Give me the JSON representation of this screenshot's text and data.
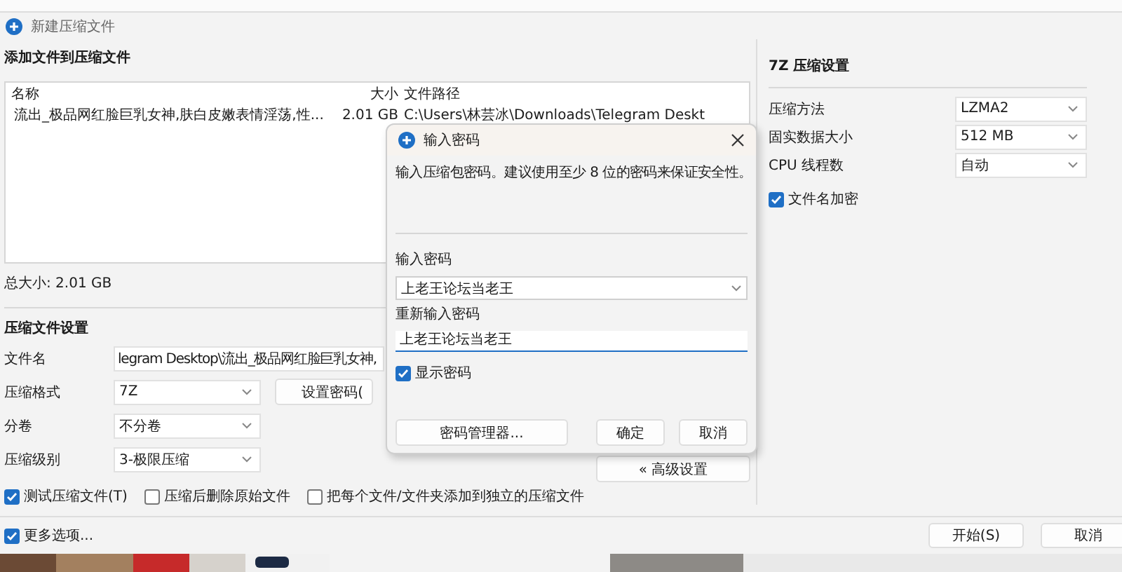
{
  "window": {
    "title": "新建压缩文件"
  },
  "add_section": {
    "heading": "添加文件到压缩文件",
    "columns": [
      "名称",
      "大小",
      "文件路径"
    ],
    "files": [
      {
        "name": "流出_极品网红脸巨乳女神,肤白皮嫩表情淫荡,性...",
        "size": "2.01 GB",
        "path": "C:\\Users\\林芸冰\\Downloads\\Telegram Deskt"
      }
    ],
    "total": "总大小: 2.01 GB"
  },
  "settings": {
    "heading": "压缩文件设置",
    "fields": [
      {
        "label": "文件名",
        "kind": "input",
        "value": "legram Desktop\\流出_极品网红脸巨乳女神,"
      },
      {
        "label": "压缩格式",
        "kind": "select",
        "value": "7Z",
        "button": {
          "label": "设置密码(",
          "kind": "inline"
        }
      },
      {
        "label": "分卷",
        "kind": "select",
        "value": "不分卷"
      },
      {
        "label": "压缩级别",
        "kind": "select",
        "value": "3-极限压缩",
        "button": {
          "label": "« 高级设置",
          "kind": "far"
        }
      }
    ],
    "options": [
      {
        "label": "测试压缩文件(T)",
        "checked": true
      },
      {
        "label": "压缩后删除原始文件",
        "checked": false
      },
      {
        "label": "把每个文件/文件夹添加到独立的压缩文件",
        "checked": false
      }
    ]
  },
  "seven_z": {
    "heading": "7Z 压缩设置",
    "fields": [
      {
        "label": "压缩方法",
        "value": "LZMA2"
      },
      {
        "label": "固实数据大小",
        "value": "512 MB"
      },
      {
        "label": "CPU 线程数",
        "value": "自动"
      }
    ],
    "options": [
      {
        "label": "文件名加密",
        "checked": true
      }
    ]
  },
  "footer": {
    "more_options": {
      "label": "更多选项...",
      "checked": true
    },
    "buttons": [
      "开始(S)",
      "取消"
    ]
  },
  "dialog": {
    "title": "输入密码",
    "description": "输入压缩包密码。建议使用至少 8 位的密码来保证安全性。",
    "password_label": "输入密码",
    "password_value": "上老王论坛当老王",
    "confirm_label": "重新输入密码",
    "confirm_value": "上老王论坛当老王",
    "show_password": {
      "label": "显示密码",
      "checked": true
    },
    "buttons": [
      "密码管理器...",
      "确定",
      "取消"
    ]
  }
}
